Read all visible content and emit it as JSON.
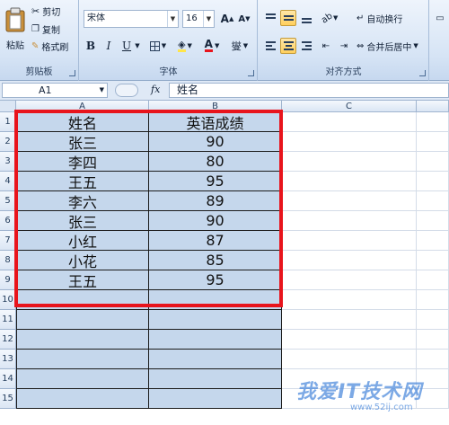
{
  "ribbon": {
    "clipboard": {
      "paste_label": "粘贴",
      "cut_label": "剪切",
      "copy_label": "复制",
      "format_painter_label": "格式刷",
      "group_label": "剪贴板"
    },
    "font": {
      "font_name": "宋体",
      "font_size": "16",
      "grow_label": "A",
      "shrink_label": "A",
      "bold_label": "B",
      "italic_label": "I",
      "underline_label": "U",
      "font_color_label": "A",
      "phonetic_label": "燮",
      "group_label": "字体"
    },
    "alignment": {
      "wrap_text_label": "自动换行",
      "merge_center_label": "合并后居中",
      "group_label": "对齐方式"
    }
  },
  "formula_bar": {
    "name_box": "A1",
    "fx_label": "fx",
    "formula": "姓名"
  },
  "columns": [
    "A",
    "B",
    "C"
  ],
  "rows": [
    "1",
    "2",
    "3",
    "4",
    "5",
    "6",
    "7",
    "8",
    "9",
    "10",
    "11",
    "12",
    "13",
    "14",
    "15"
  ],
  "table": {
    "header_name": "姓名",
    "header_score": "英语成绩",
    "records": [
      {
        "name": "张三",
        "score": "90"
      },
      {
        "name": "李四",
        "score": "80"
      },
      {
        "name": "王五",
        "score": "95"
      },
      {
        "name": "李六",
        "score": "89"
      },
      {
        "name": "张三",
        "score": "90"
      },
      {
        "name": "小红",
        "score": "87"
      },
      {
        "name": "小花",
        "score": "85"
      },
      {
        "name": "王五",
        "score": "95"
      }
    ]
  },
  "watermark": {
    "text": "我爱IT技术网",
    "url": "www.52ij.com"
  },
  "colors": {
    "selection_fill": "#c5d7ec",
    "highlight_border": "#e8141c",
    "font_color_bar": "#e8141c"
  }
}
